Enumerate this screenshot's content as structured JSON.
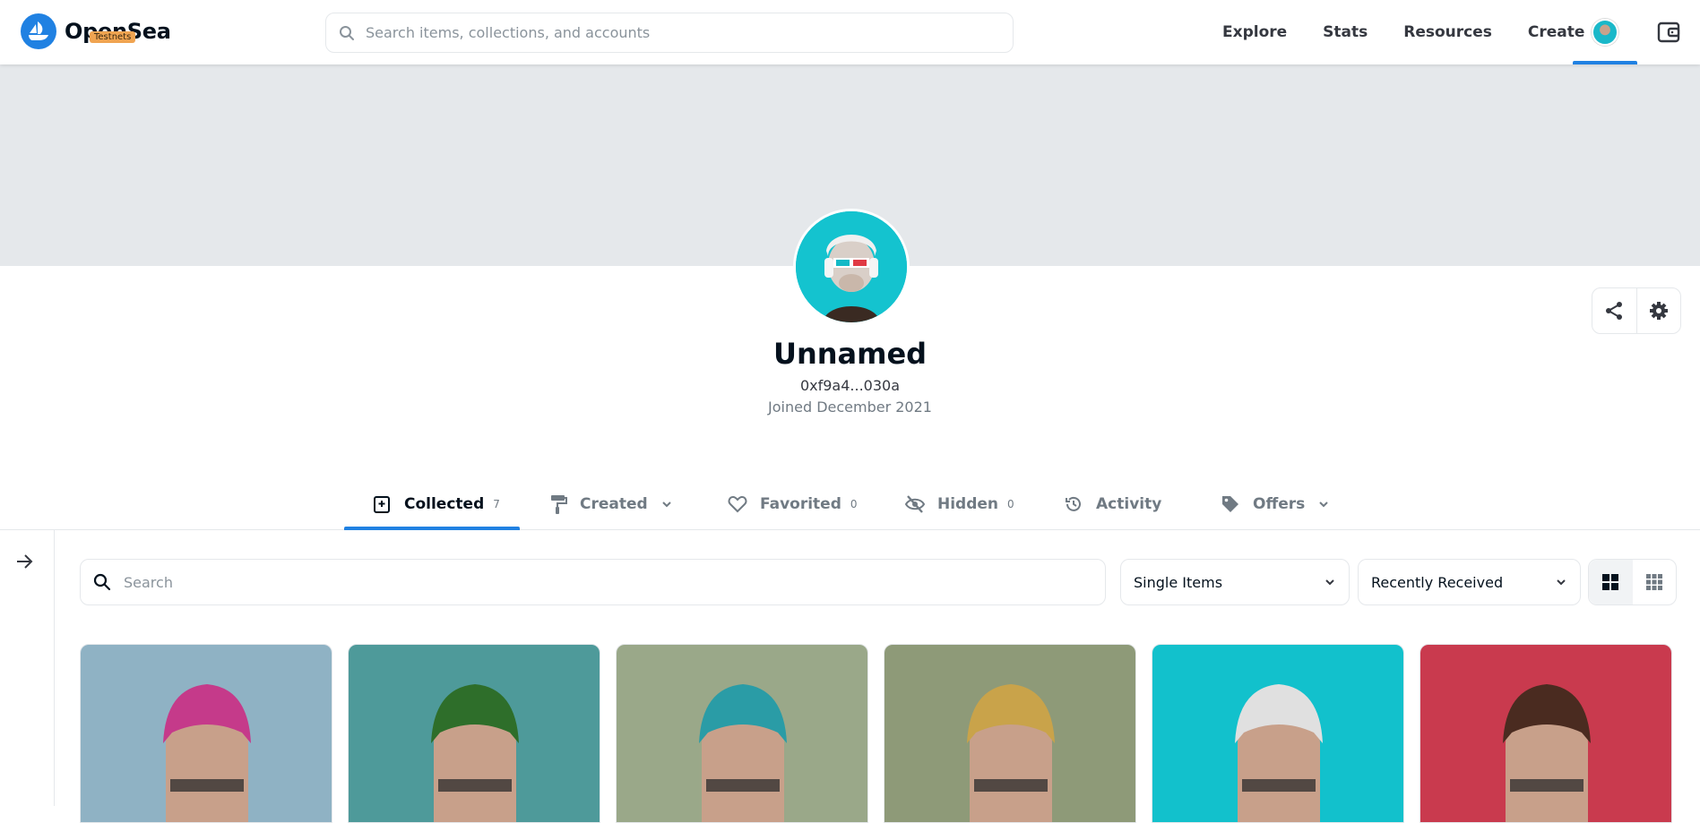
{
  "header": {
    "brand": "OpenSea",
    "badge": "Testnets",
    "search_placeholder": "Search items, collections, and accounts",
    "nav": [
      "Explore",
      "Stats",
      "Resources",
      "Create"
    ]
  },
  "profile": {
    "name": "Unnamed",
    "address": "0xf9a4...030a",
    "joined": "Joined December 2021"
  },
  "tabs": [
    {
      "label": "Collected",
      "count": "7",
      "icon": "collected-icon"
    },
    {
      "label": "Created",
      "count": "",
      "icon": "paint-roller-icon"
    },
    {
      "label": "Favorited",
      "count": "0",
      "icon": "heart-icon"
    },
    {
      "label": "Hidden",
      "count": "0",
      "icon": "eye-off-icon"
    },
    {
      "label": "Activity",
      "count": "",
      "icon": "history-icon"
    },
    {
      "label": "Offers",
      "count": "",
      "icon": "tag-icon"
    }
  ],
  "filters": {
    "search_placeholder": "Search",
    "item_type": "Single Items",
    "sort": "Recently Received"
  },
  "colors": {
    "accent": "#2081e2",
    "banner": "#e5e8eb",
    "badge": "#f0a451"
  },
  "cards": [
    {
      "bg": "#8fb2c4",
      "accent": "#c53a8a"
    },
    {
      "bg": "#4e9a9a",
      "accent": "#2e6e2a"
    },
    {
      "bg": "#9aa889",
      "accent": "#2a9ca6"
    },
    {
      "bg": "#8e9a78",
      "accent": "#c9a34a"
    },
    {
      "bg": "#12c1cc",
      "accent": "#e0e0e0"
    },
    {
      "bg": "#c93a4e",
      "accent": "#4a2b20"
    }
  ]
}
